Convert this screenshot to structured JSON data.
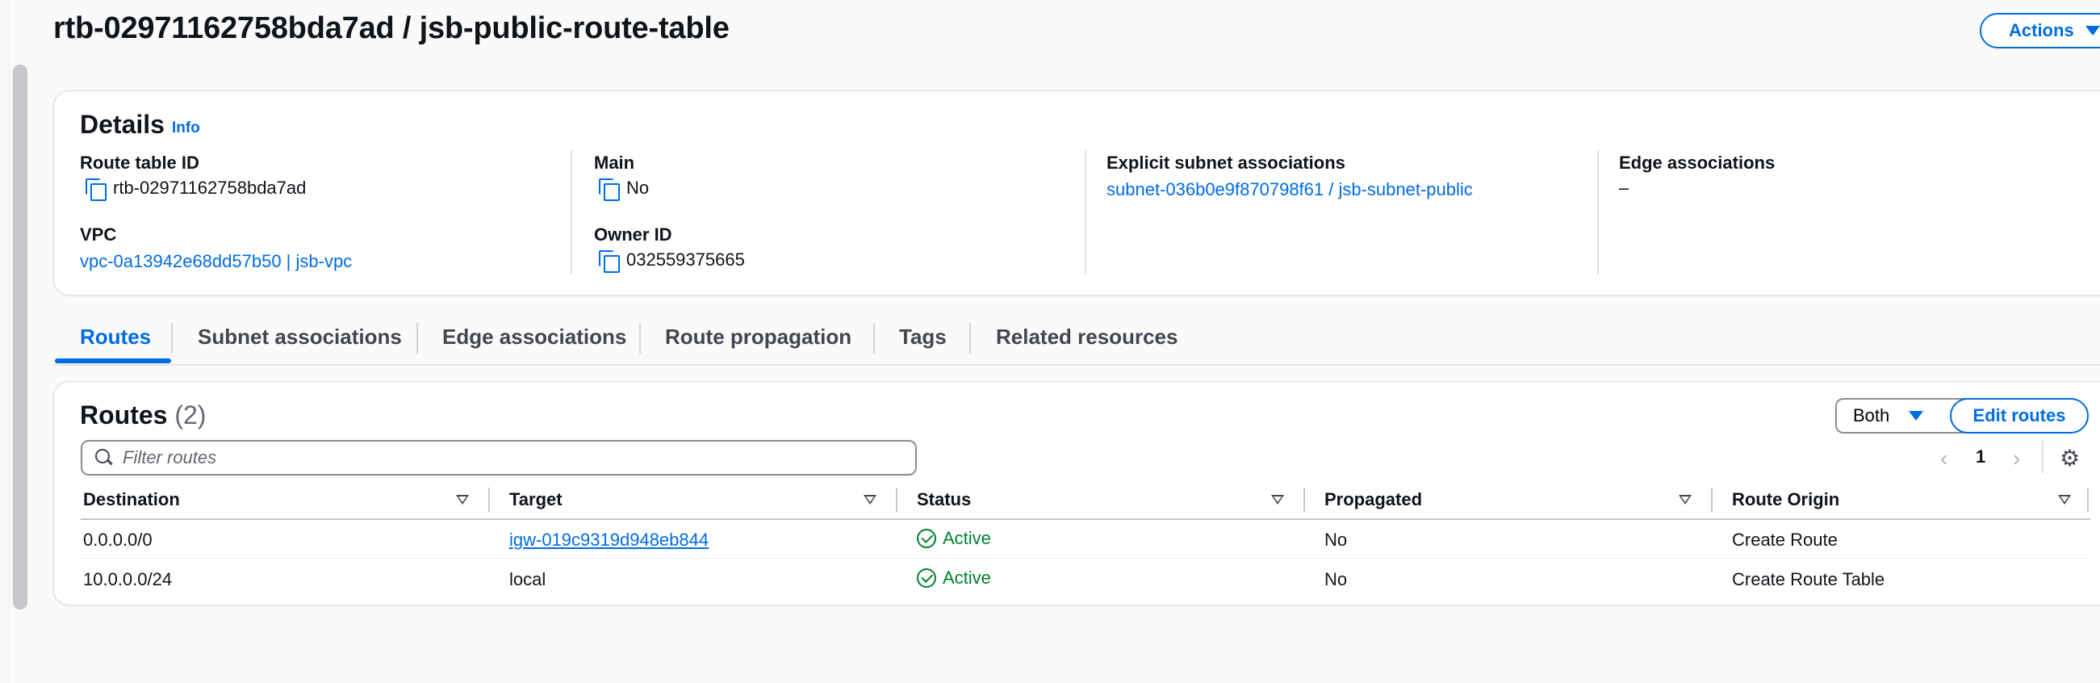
{
  "page": {
    "title": "rtb-02971162758bda7ad / jsb-public-route-table",
    "actions_label": "Actions"
  },
  "details": {
    "heading": "Details",
    "info_label": "Info",
    "route_table_id_label": "Route table ID",
    "route_table_id": "rtb-02971162758bda7ad",
    "vpc_label": "VPC",
    "vpc_value": "vpc-0a13942e68dd57b50 | jsb-vpc",
    "main_label": "Main",
    "main_value": "No",
    "owner_id_label": "Owner ID",
    "owner_id": "032559375665",
    "explicit_subnet_label": "Explicit subnet associations",
    "explicit_subnet_value": "subnet-036b0e9f870798f61 / jsb-subnet-public",
    "edge_assoc_label": "Edge associations",
    "edge_assoc_value": "–"
  },
  "tabs": [
    {
      "label": "Routes",
      "active": true
    },
    {
      "label": "Subnet associations"
    },
    {
      "label": "Edge associations"
    },
    {
      "label": "Route propagation"
    },
    {
      "label": "Tags"
    },
    {
      "label": "Related resources"
    }
  ],
  "routes": {
    "heading": "Routes",
    "count": "(2)",
    "both_label": "Both",
    "edit_label": "Edit routes",
    "filter_placeholder": "Filter routes",
    "page_prev": "‹",
    "page_number": "1",
    "page_next": "›",
    "columns": [
      "Destination",
      "Target",
      "Status",
      "Propagated",
      "Route Origin"
    ],
    "rows": [
      {
        "destination": "0.0.0.0/0",
        "target": "igw-019c9319d948eb844",
        "target_is_link": true,
        "status": "Active",
        "propagated": "No",
        "origin": "Create Route"
      },
      {
        "destination": "10.0.0.0/24",
        "target": "local",
        "target_is_link": false,
        "status": "Active",
        "propagated": "No",
        "origin": "Create Route Table"
      }
    ]
  },
  "colors": {
    "accent": "#006ce0",
    "success": "#00802f",
    "text": "#0f141a"
  },
  "icons": [
    "copy-icon",
    "search-icon",
    "gear-icon",
    "check-circle-icon",
    "chevron-left-icon",
    "chevron-right-icon",
    "caret-down-icon",
    "filter-icon"
  ]
}
